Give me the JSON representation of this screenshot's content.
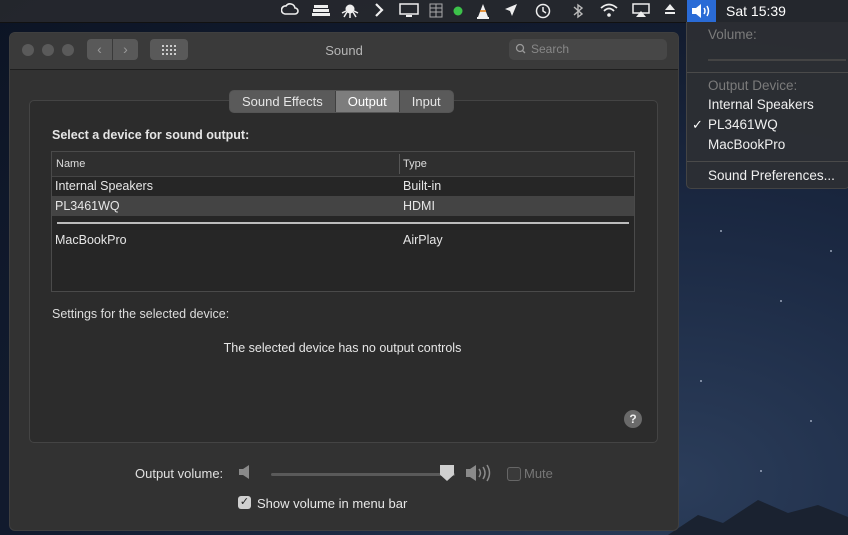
{
  "menubar": {
    "clock": "Sat 15:39",
    "icons": [
      "creative-cloud-icon",
      "ship-icon",
      "octopus-icon",
      "chevron-icon",
      "display-icon",
      "grid-icon",
      "green-dot-icon",
      "vlc-cone-icon",
      "location-arrow-icon",
      "time-machine-icon",
      "bluetooth-icon",
      "wifi-icon",
      "airplay-icon",
      "eject-icon",
      "volume-icon"
    ]
  },
  "window": {
    "title": "Sound",
    "search_placeholder": "Search",
    "tabs": [
      {
        "label": "Sound Effects",
        "active": false
      },
      {
        "label": "Output",
        "active": true
      },
      {
        "label": "Input",
        "active": false
      }
    ],
    "heading": "Select a device for sound output:",
    "table": {
      "columns": [
        "Name",
        "Type"
      ],
      "rows": [
        {
          "name": "Internal Speakers",
          "type": "Built-in",
          "selected": false
        },
        {
          "name": "PL3461WQ",
          "type": "HDMI",
          "selected": true
        },
        {
          "name": "MacBookPro",
          "type": "AirPlay",
          "selected": false
        }
      ]
    },
    "settings_label": "Settings for the selected device:",
    "no_controls": "The selected device has no output controls",
    "help": "?",
    "output_volume_label": "Output volume:",
    "volume_level": 0.95,
    "mute_label": "Mute",
    "mute_checked": false,
    "show_volume_label": "Show volume in menu bar",
    "show_volume_checked": true,
    "checkmark": "✓"
  },
  "dropdown": {
    "volume_label": "Volume:",
    "output_device_label": "Output Device:",
    "devices": [
      {
        "name": "Internal Speakers",
        "checked": false
      },
      {
        "name": "PL3461WQ",
        "checked": true
      },
      {
        "name": "MacBookPro",
        "checked": false
      }
    ],
    "check": "✓",
    "preferences": "Sound Preferences..."
  },
  "colors": {
    "accent": "#2a6bd6",
    "window_bg": "#323232",
    "panel_bg": "#2c2c2c"
  }
}
